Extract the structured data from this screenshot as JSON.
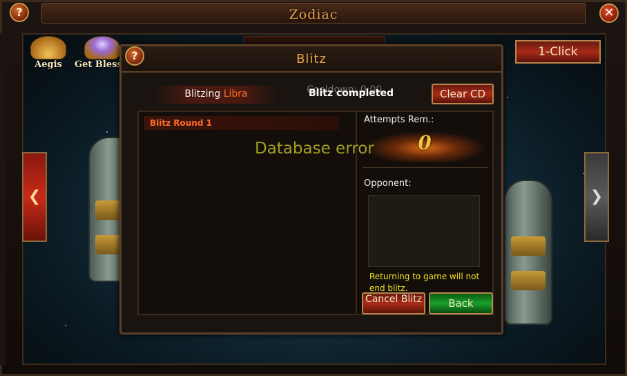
{
  "window": {
    "title": "Zodiac"
  },
  "top_icons": {
    "aegis_label": "Aegis",
    "get_blessing_label": "Get Blessi"
  },
  "one_click_label": "1-Click",
  "dialog": {
    "title": "Blitz",
    "blitzing_prefix": "Blitzing ",
    "blitzing_sign": "Libra",
    "status": "Blitz completed",
    "cooldown_text": "Cooldown: 0:00",
    "clear_cd_label": "Clear CD",
    "rounds": [
      {
        "label": "Blitz Round 1"
      }
    ],
    "attempts_label": "Attempts Rem.:",
    "attempts_value": "0",
    "opponent_label": "Opponent:",
    "notice": "Returning to game will not end blitz.",
    "cancel_label": "Cancel Blitz",
    "back_label": "Back"
  },
  "overlay_error": "Database error",
  "colors": {
    "accent_orange": "#e8a24a",
    "sign_orange": "#ff6a2a",
    "notice_yellow": "#f0e020",
    "error_olive": "#a0a020",
    "back_green": "#18a028",
    "button_red": "#a82a18"
  },
  "icons": {
    "help": "question-mark",
    "close": "x",
    "nav_left": "left-arrow",
    "nav_right": "right-arrow"
  }
}
